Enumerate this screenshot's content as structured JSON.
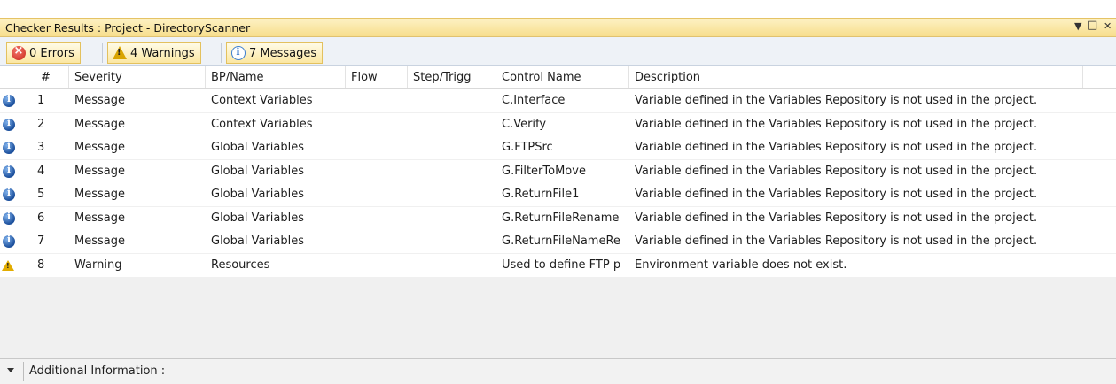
{
  "window": {
    "title": "Checker Results : Project - DirectoryScanner",
    "controls": {
      "menu": "▼",
      "maximize": "□",
      "close": "✕"
    }
  },
  "toolbar": {
    "errors": {
      "label": "0 Errors",
      "icon": "error-icon"
    },
    "warnings": {
      "label": "4 Warnings",
      "icon": "warning-icon"
    },
    "messages": {
      "label": "7 Messages",
      "icon": "info-icon"
    }
  },
  "table": {
    "columns": [
      "#",
      "Severity",
      "BP/Name",
      "Flow",
      "Step/Trigg",
      "Control Name",
      "Description"
    ],
    "rows": [
      {
        "icon": "info",
        "num": "1",
        "severity": "Message",
        "bp": "Context Variables",
        "flow": "",
        "step": "",
        "control": "C.Interface",
        "desc": "Variable defined in the Variables Repository is not used in the project."
      },
      {
        "icon": "info",
        "num": "2",
        "severity": "Message",
        "bp": "Context Variables",
        "flow": "",
        "step": "",
        "control": "C.Verify",
        "desc": "Variable defined in the Variables Repository is not used in the project."
      },
      {
        "icon": "info",
        "num": "3",
        "severity": "Message",
        "bp": "Global Variables",
        "flow": "",
        "step": "",
        "control": "G.FTPSrc",
        "desc": "Variable defined in the Variables Repository is not used in the project."
      },
      {
        "icon": "info",
        "num": "4",
        "severity": "Message",
        "bp": "Global Variables",
        "flow": "",
        "step": "",
        "control": "G.FilterToMove",
        "desc": "Variable defined in the Variables Repository is not used in the project."
      },
      {
        "icon": "info",
        "num": "5",
        "severity": "Message",
        "bp": "Global Variables",
        "flow": "",
        "step": "",
        "control": "G.ReturnFile1",
        "desc": "Variable defined in the Variables Repository is not used in the project."
      },
      {
        "icon": "info",
        "num": "6",
        "severity": "Message",
        "bp": "Global Variables",
        "flow": "",
        "step": "",
        "control": "G.ReturnFileRename",
        "desc": "Variable defined in the Variables Repository is not used in the project."
      },
      {
        "icon": "info",
        "num": "7",
        "severity": "Message",
        "bp": "Global Variables",
        "flow": "",
        "step": "",
        "control": "G.ReturnFileNameRe",
        "desc": "Variable defined in the Variables Repository is not used in the project."
      },
      {
        "icon": "warning",
        "num": "8",
        "severity": "Warning",
        "bp": "Resources",
        "flow": "",
        "step": "",
        "control": "Used to define FTP p",
        "desc": "Environment variable does not exist."
      }
    ]
  },
  "footer": {
    "label": "Additional Information :"
  }
}
